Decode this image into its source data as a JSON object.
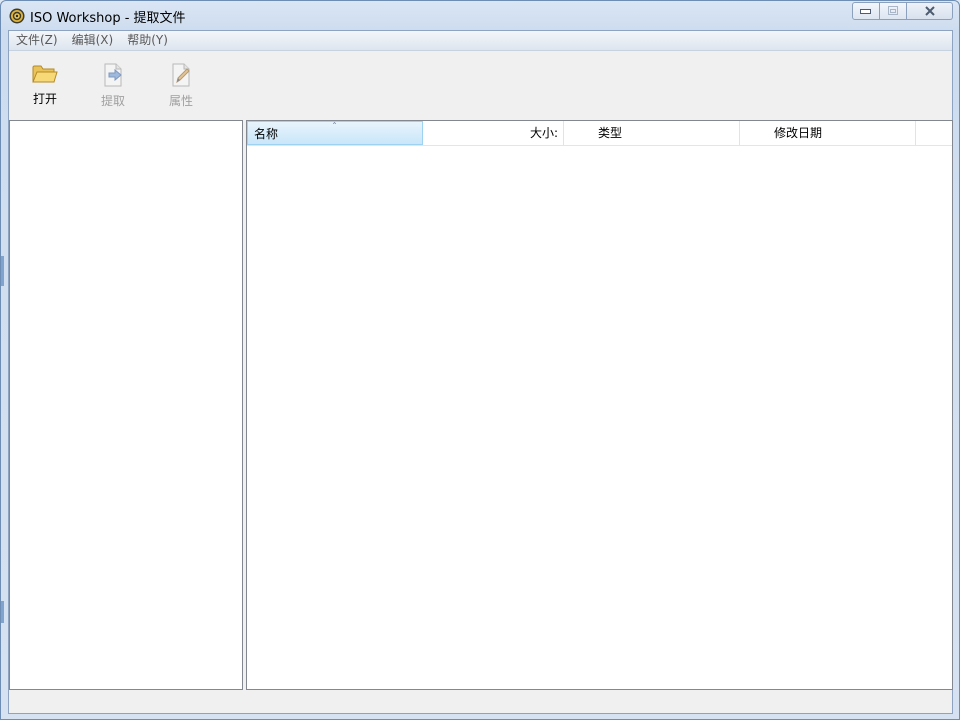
{
  "window": {
    "title": "ISO Workshop - 提取文件",
    "icon": "iso-workshop-disc-icon"
  },
  "menubar": {
    "items": [
      {
        "label": "文件(Z)"
      },
      {
        "label": "编辑(X)"
      },
      {
        "label": "帮助(Y)"
      }
    ]
  },
  "toolbar": {
    "open_label": "打开",
    "extract_label": "提取",
    "properties_label": "属性",
    "open_icon": "folder-open-icon",
    "extract_icon": "extract-page-icon",
    "properties_icon": "edit-page-icon"
  },
  "list": {
    "columns": [
      {
        "label": "名称"
      },
      {
        "label": "大小:"
      },
      {
        "label": "类型"
      },
      {
        "label": "修改日期"
      }
    ],
    "sort_indicator": "ˆ"
  },
  "colors": {
    "accent": "#9ed2f1",
    "frame": "#6d8db4"
  }
}
